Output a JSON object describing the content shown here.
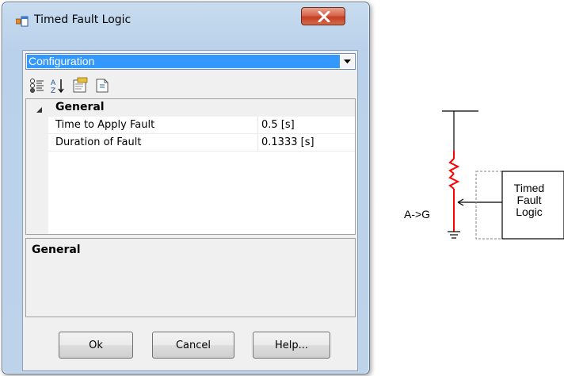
{
  "window": {
    "title": "Timed Fault Logic"
  },
  "combo": {
    "selected": "Configuration"
  },
  "toolbar": {
    "buttons": [
      "categorized-view-icon",
      "alphabetical-sort-icon",
      "property-pages-icon",
      "events-icon"
    ]
  },
  "property_grid": {
    "category": "General",
    "rows": [
      {
        "name": "Time to Apply Fault",
        "value": "0.5 [s]"
      },
      {
        "name": "Duration of Fault",
        "value": "0.1333 [s]"
      }
    ]
  },
  "description": {
    "title": "General"
  },
  "buttons": {
    "ok": "Ok",
    "cancel": "Cancel",
    "help": "Help..."
  },
  "diagram": {
    "fault_type": "A->G",
    "block_line1": "Timed",
    "block_line2": "Fault",
    "block_line3": "Logic",
    "colors": {
      "fault": "#ff0000",
      "line": "#000000",
      "dashed": "#808080"
    }
  }
}
